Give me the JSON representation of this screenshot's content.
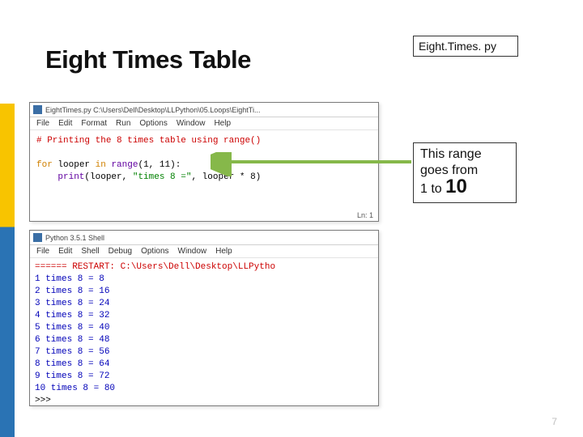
{
  "title": "Eight Times Table",
  "filename_box": "Eight.Times. py",
  "editor": {
    "title": "EightTimes.py  C:\\Users\\Dell\\Desktop\\LLPython\\05.Loops\\EightTi...",
    "menus": [
      "File",
      "Edit",
      "Format",
      "Run",
      "Options",
      "Window",
      "Help"
    ],
    "comment": "# Printing the 8 times table using range()",
    "kw_for": "for",
    "ident_looper": "looper",
    "kw_in": "in",
    "range_call": "range",
    "range_args": "(1, 11)",
    "colon": ":",
    "print_call": "print",
    "print_inside_a": "(looper, ",
    "print_str": "\"times 8 =\"",
    "print_inside_b": ", looper * 8)",
    "status": "Ln: 1"
  },
  "shell": {
    "title": "Python 3.5.1 Shell",
    "menus": [
      "File",
      "Edit",
      "Shell",
      "Debug",
      "Options",
      "Window",
      "Help"
    ],
    "restart_line": "====== RESTART: C:\\Users\\Dell\\Desktop\\LLPytho",
    "lines": [
      "1 times 8 = 8",
      "2 times 8 = 16",
      "3 times 8 = 24",
      "4 times 8 = 32",
      "5 times 8 = 40",
      "6 times 8 = 48",
      "7 times 8 = 56",
      "8 times 8 = 64",
      "9 times 8 = 72",
      "10 times 8 = 80"
    ],
    "prompt": ">>>"
  },
  "range_callout": {
    "line1": "This range",
    "line2": "goes from",
    "line3a": "1 to ",
    "line3b": "10"
  },
  "page_number": "7"
}
